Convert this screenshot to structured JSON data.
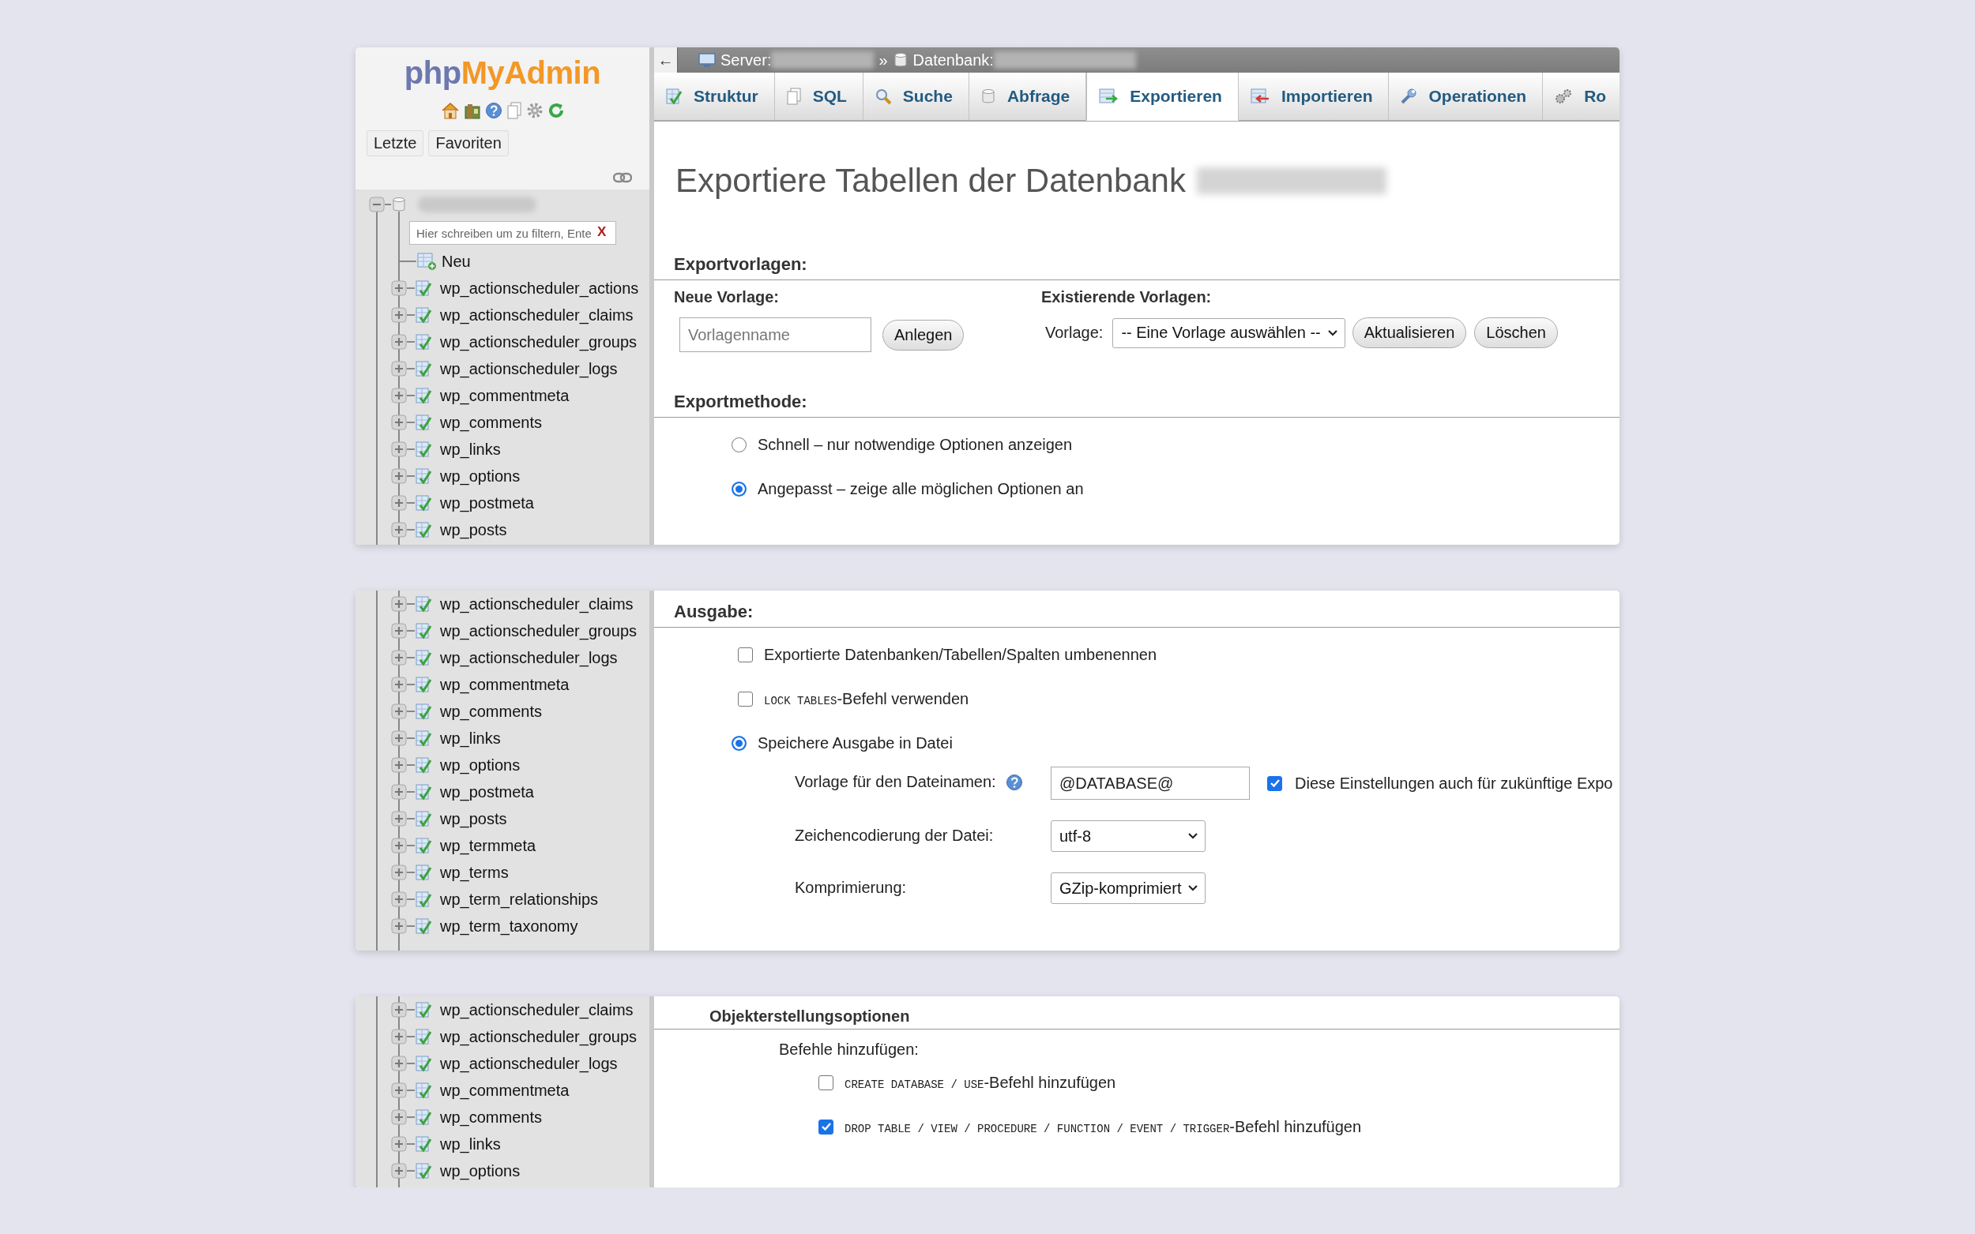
{
  "panels": [
    {
      "sidebar": {
        "logo": [
          "php",
          "MyAdmin"
        ],
        "nav_tabs": [
          "Letzte",
          "Favoriten"
        ],
        "database": {
          "expanded": true,
          "filter_placeholder": "Hier schreiben um zu filtern, Ente",
          "clear": "X",
          "new_item": "Neu"
        },
        "tables": [
          {
            "name": "wp_actionscheduler_actions",
            "expanded": false
          },
          {
            "name": "wp_actionscheduler_claims",
            "expanded": false
          },
          {
            "name": "wp_actionscheduler_groups",
            "expanded": false
          },
          {
            "name": "wp_actionscheduler_logs",
            "expanded": false
          },
          {
            "name": "wp_commentmeta",
            "expanded": false
          },
          {
            "name": "wp_comments",
            "expanded": false
          },
          {
            "name": "wp_links",
            "expanded": false
          },
          {
            "name": "wp_options",
            "expanded": false
          },
          {
            "name": "wp_postmeta",
            "expanded": false
          },
          {
            "name": "wp_posts",
            "expanded": false
          }
        ]
      },
      "header": {
        "back": "←",
        "server_label": "Server:",
        "separator": "»",
        "database_label": "Datenbank:",
        "tabs": [
          {
            "label": "Struktur",
            "selected": false
          },
          {
            "label": "SQL",
            "selected": false
          },
          {
            "label": "Suche",
            "selected": false
          },
          {
            "label": "Abfrage",
            "selected": false
          },
          {
            "label": "Exportieren",
            "selected": true
          },
          {
            "label": "Importieren",
            "selected": false
          },
          {
            "label": "Operationen",
            "selected": false
          },
          {
            "label": "Ro",
            "selected": false
          }
        ]
      },
      "title": "Exportiere Tabellen der Datenbank",
      "sections": [
        {
          "kind": "templates",
          "heading": "Exportvorlagen:",
          "new": {
            "heading": "Neue Vorlage:",
            "placeholder": "Vorlagenname",
            "button": "Anlegen"
          },
          "existing": {
            "heading": "Existierende Vorlagen:",
            "label": "Vorlage:",
            "select": "-- Eine Vorlage auswählen --",
            "buttons": [
              "Aktualisieren",
              "Löschen"
            ]
          }
        },
        {
          "kind": "options",
          "heading": "Exportmethode:",
          "options": [
            {
              "kind": "radio",
              "label": "Schnell – nur notwendige Optionen anzeigen",
              "selected": false
            },
            {
              "kind": "radio",
              "label": "Angepasst – zeige alle möglichen Optionen an",
              "selected": true
            }
          ]
        }
      ]
    },
    {
      "sidebar": {
        "tables": [
          {
            "name": "wp_actionscheduler_claims",
            "expanded": false
          },
          {
            "name": "wp_actionscheduler_groups",
            "expanded": false
          },
          {
            "name": "wp_actionscheduler_logs",
            "expanded": false
          },
          {
            "name": "wp_commentmeta",
            "expanded": false
          },
          {
            "name": "wp_comments",
            "expanded": false
          },
          {
            "name": "wp_links",
            "expanded": false
          },
          {
            "name": "wp_options",
            "expanded": false
          },
          {
            "name": "wp_postmeta",
            "expanded": false
          },
          {
            "name": "wp_posts",
            "expanded": false
          },
          {
            "name": "wp_termmeta",
            "expanded": false
          },
          {
            "name": "wp_terms",
            "expanded": false
          },
          {
            "name": "wp_term_relationships",
            "expanded": false
          },
          {
            "name": "wp_term_taxonomy",
            "expanded": false
          }
        ]
      },
      "sections": [
        {
          "kind": "options",
          "heading": "Ausgabe:",
          "options": [
            {
              "kind": "checkbox",
              "label": "Exportierte Datenbanken/Tabellen/Spalten umbenennen",
              "checked": false
            },
            {
              "kind": "checkbox",
              "code": "LOCK TABLES",
              "label": "-Befehl verwenden",
              "checked": false
            },
            {
              "kind": "radio",
              "label": "Speichere Ausgabe in Datei",
              "selected": true
            }
          ],
          "fields": [
            {
              "kind": "text",
              "label": "Vorlage für den Dateinamen:",
              "help": true,
              "value": "@DATABASE@",
              "checkbox": {
                "checked": true,
                "label": "Diese Einstellungen auch für zukünftige Expo"
              }
            },
            {
              "kind": "select",
              "label": "Zeichencodierung der Datei:",
              "value": "utf-8"
            },
            {
              "kind": "select",
              "label": "Komprimierung:",
              "value": "GZip-komprimiert"
            }
          ]
        }
      ]
    },
    {
      "sidebar": {
        "tables": [
          {
            "name": "wp_actionscheduler_claims",
            "expanded": false
          },
          {
            "name": "wp_actionscheduler_groups",
            "expanded": false
          },
          {
            "name": "wp_actionscheduler_logs",
            "expanded": false
          },
          {
            "name": "wp_commentmeta",
            "expanded": false
          },
          {
            "name": "wp_comments",
            "expanded": false
          },
          {
            "name": "wp_links",
            "expanded": false
          },
          {
            "name": "wp_options",
            "expanded": false
          }
        ]
      },
      "sections": [
        {
          "kind": "subgroup",
          "heading": "Objekterstellungsoptionen",
          "subheading": "Befehle hinzufügen:",
          "options": [
            {
              "kind": "checkbox",
              "code": "CREATE DATABASE / USE",
              "label": "-Befehl hinzufügen",
              "checked": false
            },
            {
              "kind": "checkbox",
              "code": "DROP TABLE / VIEW / PROCEDURE / FUNCTION / EVENT / TRIGGER",
              "label": "-Befehl hinzufügen",
              "checked": true
            }
          ]
        }
      ]
    }
  ]
}
